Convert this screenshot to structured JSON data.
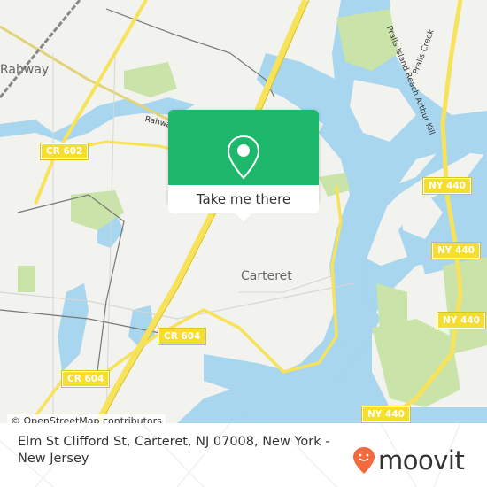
{
  "map": {
    "place_labels": {
      "rahway": "Rahway",
      "carteret": "Carteret"
    },
    "water_labels": {
      "rahway_river": "Rahway",
      "pralls_island_reach": "Pralls Island Reach Arthur Kill",
      "pralls_creek": "Pralls Creek"
    },
    "road_shields": {
      "cr602": "CR 602",
      "cr604_east": "CR 604",
      "cr604_west": "CR 604",
      "ny440_a": "NY 440",
      "ny440_b": "NY 440",
      "ny440_c": "NY 440",
      "ny440_d": "NY 440"
    },
    "attribution": "© OpenStreetMap contributors",
    "colors": {
      "land": "#f2f2ee",
      "water": "#a7d6ee",
      "park": "#c9e3a8",
      "highway": "#f7e25c",
      "popup_green": "#1db86c"
    }
  },
  "popup": {
    "icon": "location-pin-icon",
    "button_label": "Take me there"
  },
  "footer": {
    "address": "Elm St Clifford St, Carteret, NJ 07008, New York - New Jersey",
    "brand": "moovit",
    "brand_color": "#f26a3d"
  }
}
